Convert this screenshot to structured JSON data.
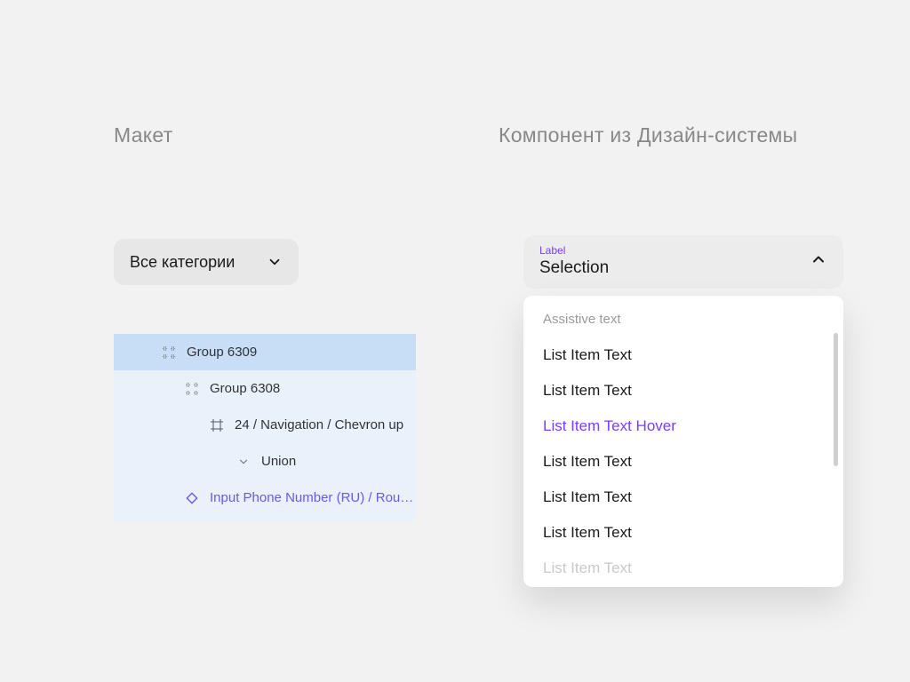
{
  "headings": {
    "left": "Макет",
    "right": "Компонент из Дизайн-системы"
  },
  "dropdown": {
    "label": "Все категории"
  },
  "layers": [
    {
      "indent": 54,
      "icon": "group",
      "label": "Group 6309",
      "selected": true
    },
    {
      "indent": 80,
      "icon": "group",
      "label": "Group 6308"
    },
    {
      "indent": 108,
      "icon": "frame",
      "label": "24 / Navigation / Chevron up"
    },
    {
      "indent": 138,
      "icon": "vector",
      "label": "Union"
    },
    {
      "indent": 80,
      "icon": "instance",
      "label": "Input Phone Number (RU) / Rou…",
      "instance": true
    }
  ],
  "select": {
    "label": "Label",
    "value": "Selection",
    "assistive": "Assistive text",
    "items": [
      {
        "text": "List Item Text"
      },
      {
        "text": "List Item Text"
      },
      {
        "text": "List Item Text Hover",
        "hover": true
      },
      {
        "text": "List Item Text"
      },
      {
        "text": "List Item Text"
      },
      {
        "text": "List Item Text"
      },
      {
        "text": "List Item Text",
        "faded": true
      }
    ]
  }
}
